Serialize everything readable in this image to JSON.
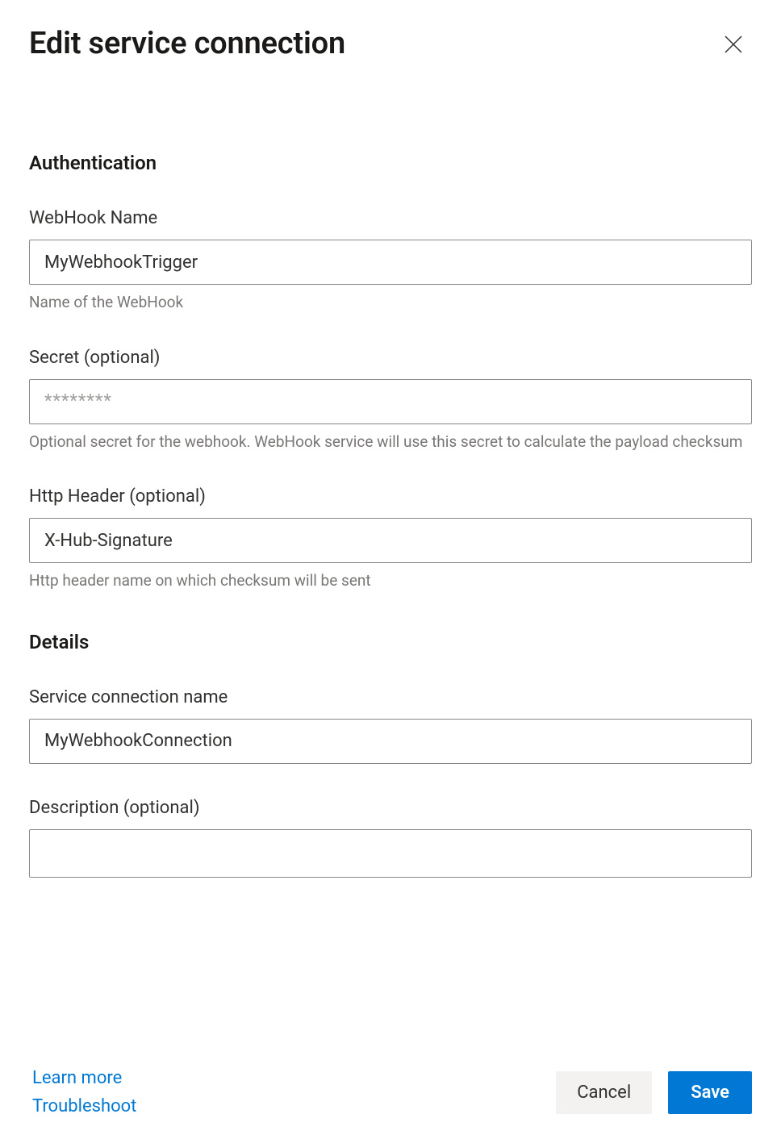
{
  "header": {
    "title": "Edit service connection"
  },
  "sections": {
    "authentication": {
      "heading": "Authentication",
      "webhook_name": {
        "label": "WebHook Name",
        "value": "MyWebhookTrigger",
        "helper": "Name of the WebHook"
      },
      "secret": {
        "label": "Secret (optional)",
        "placeholder": "********",
        "helper": "Optional secret for the webhook. WebHook service will use this secret to calculate the payload checksum"
      },
      "http_header": {
        "label": "Http Header (optional)",
        "value": "X-Hub-Signature",
        "helper": "Http header name on which checksum will be sent"
      }
    },
    "details": {
      "heading": "Details",
      "service_connection_name": {
        "label": "Service connection name",
        "value": "MyWebhookConnection"
      },
      "description": {
        "label": "Description (optional)"
      }
    }
  },
  "footer": {
    "learn_more": "Learn more",
    "troubleshoot": "Troubleshoot",
    "cancel": "Cancel",
    "save": "Save"
  }
}
